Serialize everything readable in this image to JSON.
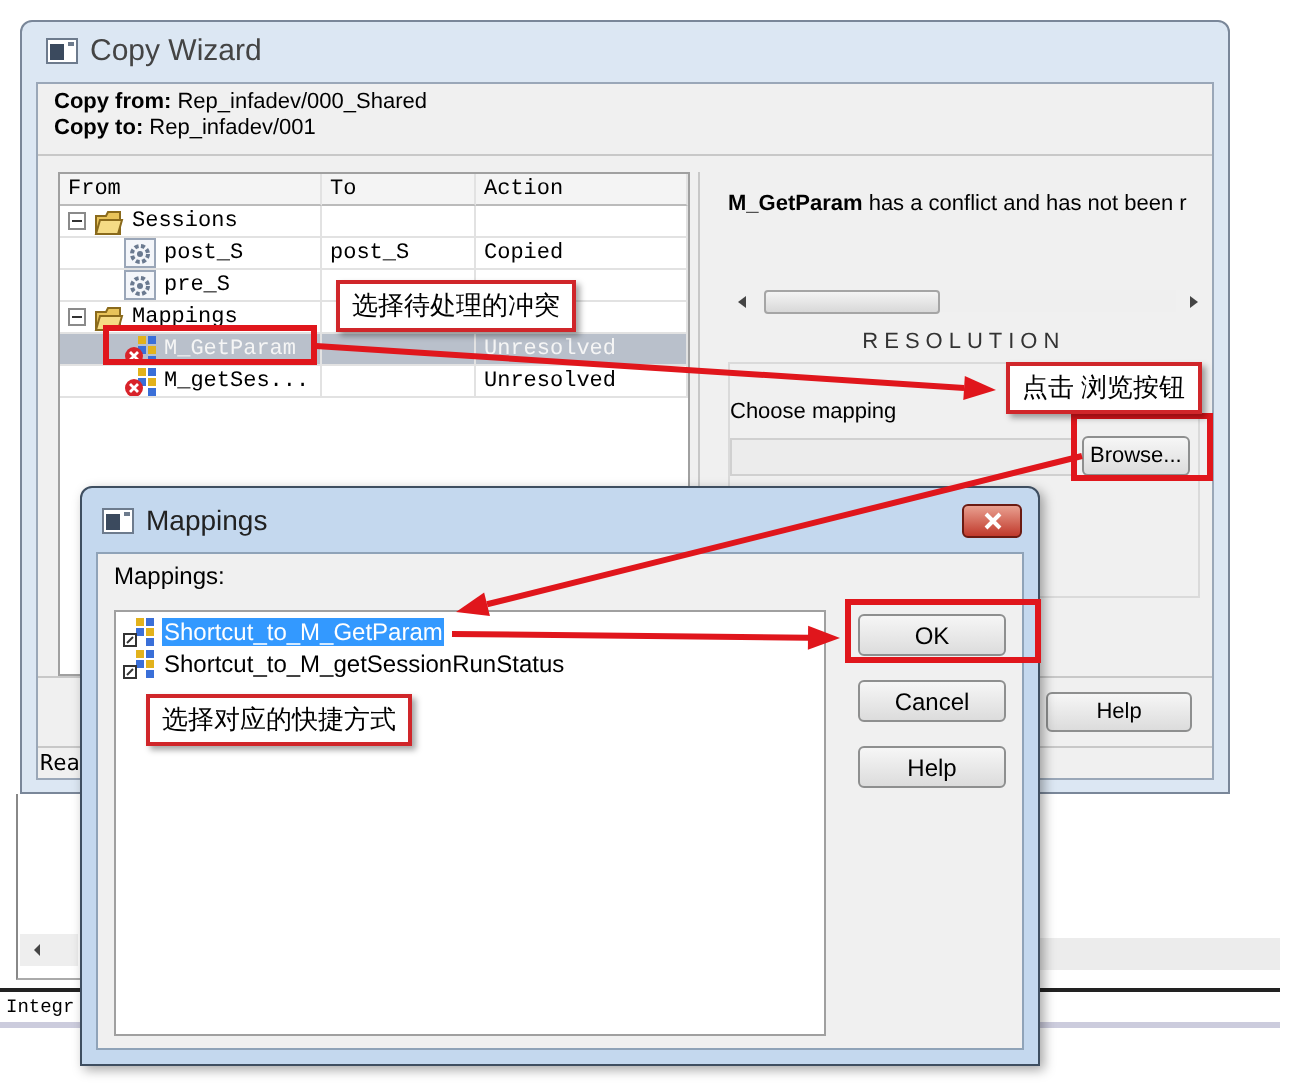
{
  "copy_wizard": {
    "title": "Copy Wizard",
    "copy_from_label": "Copy from:",
    "copy_from": "Rep_infadev/000_Shared",
    "copy_to_label": "Copy to:",
    "copy_to": "Rep_infadev/001",
    "columns": [
      "From",
      "To",
      "Action"
    ],
    "tree": [
      {
        "label": "Sessions",
        "kind": "folder",
        "expanded": true,
        "selected": false,
        "children": [
          {
            "label": "post_S",
            "kind": "session",
            "to": "post_S",
            "action": "Copied",
            "selected": false
          },
          {
            "label": "pre_S",
            "kind": "session",
            "selected": false
          }
        ]
      },
      {
        "label": "Mappings",
        "kind": "folder",
        "expanded": true,
        "selected": false,
        "children": [
          {
            "label": "M_GetParam",
            "kind": "mapping",
            "conflict": true,
            "action": "Unresolved",
            "selected": true
          },
          {
            "label": "M_getSes...",
            "kind": "mapping",
            "conflict": true,
            "action": "Unresolved",
            "selected": false
          }
        ]
      }
    ],
    "message": "**M_GetParam** has a conflict and has not been r",
    "resolution_heading": "RESOLUTION",
    "choose_label": "Choose mapping",
    "browse_button": "Browse...",
    "help_button": "Help",
    "status": "Rea"
  },
  "mappings_dialog": {
    "title": "Mappings",
    "list_label": "Mappings:",
    "items": [
      {
        "label": "Shortcut_to_M_GetParam",
        "selected": true
      },
      {
        "label": "Shortcut_to_M_getSessionRunStatus",
        "selected": false
      }
    ],
    "buttons": [
      "OK",
      "Cancel",
      "Help"
    ]
  },
  "background": {
    "status_text": "Integr"
  },
  "annotations": [
    {
      "text": "选择待处理的冲突"
    },
    {
      "text": "点击 浏览按钮"
    },
    {
      "text": "选择对应的快捷方式"
    }
  ]
}
